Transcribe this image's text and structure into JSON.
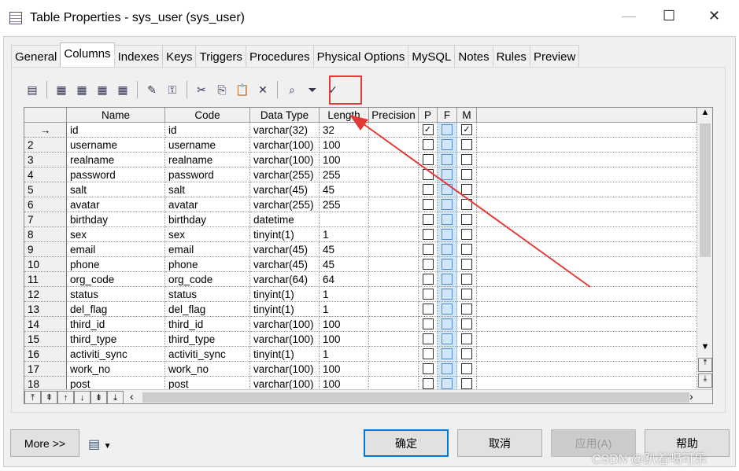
{
  "window": {
    "title": "Table Properties - sys_user (sys_user)",
    "minimize": "—",
    "maximize": "☐",
    "close": "✕"
  },
  "tabs": [
    "General",
    "Columns",
    "Indexes",
    "Keys",
    "Triggers",
    "Procedures",
    "Physical Options",
    "MySQL",
    "Notes",
    "Rules",
    "Preview"
  ],
  "active_tab": "Columns",
  "toolbar": [
    {
      "name": "properties-icon",
      "glyph": "▤"
    },
    {
      "sep": true
    },
    {
      "name": "insert-row-icon",
      "glyph": "▦"
    },
    {
      "name": "add-row-icon",
      "glyph": "▦"
    },
    {
      "name": "add-columns-icon",
      "glyph": "▦"
    },
    {
      "name": "replicate-columns-icon",
      "glyph": "▦"
    },
    {
      "sep": true
    },
    {
      "name": "new-key-icon",
      "glyph": "✎"
    },
    {
      "name": "key-icon",
      "glyph": "⚿"
    },
    {
      "sep": true
    },
    {
      "name": "cut-icon",
      "glyph": "✂"
    },
    {
      "name": "copy-icon",
      "glyph": "⎘"
    },
    {
      "name": "paste-icon",
      "glyph": "📋"
    },
    {
      "name": "delete-icon",
      "glyph": "✕"
    },
    {
      "sep": true
    },
    {
      "name": "find-icon",
      "glyph": "⌕"
    },
    {
      "name": "customize-columns-filter-icon",
      "glyph": "⏷"
    },
    {
      "name": "filter-check-icon",
      "glyph": "✓"
    }
  ],
  "columns": [
    "Name",
    "Code",
    "Data Type",
    "Length",
    "Precision",
    "P",
    "F",
    "M"
  ],
  "rows": [
    {
      "n": "→",
      "name": "id",
      "code": "id",
      "type": "varchar(32)",
      "len": "32",
      "p": true,
      "m": true
    },
    {
      "n": "2",
      "name": "username",
      "code": "username",
      "type": "varchar(100)",
      "len": "100"
    },
    {
      "n": "3",
      "name": "realname",
      "code": "realname",
      "type": "varchar(100)",
      "len": "100"
    },
    {
      "n": "4",
      "name": "password",
      "code": "password",
      "type": "varchar(255)",
      "len": "255"
    },
    {
      "n": "5",
      "name": "salt",
      "code": "salt",
      "type": "varchar(45)",
      "len": "45"
    },
    {
      "n": "6",
      "name": "avatar",
      "code": "avatar",
      "type": "varchar(255)",
      "len": "255"
    },
    {
      "n": "7",
      "name": "birthday",
      "code": "birthday",
      "type": "datetime",
      "len": ""
    },
    {
      "n": "8",
      "name": "sex",
      "code": "sex",
      "type": "tinyint(1)",
      "len": "1"
    },
    {
      "n": "9",
      "name": "email",
      "code": "email",
      "type": "varchar(45)",
      "len": "45"
    },
    {
      "n": "10",
      "name": "phone",
      "code": "phone",
      "type": "varchar(45)",
      "len": "45"
    },
    {
      "n": "11",
      "name": "org_code",
      "code": "org_code",
      "type": "varchar(64)",
      "len": "64"
    },
    {
      "n": "12",
      "name": "status",
      "code": "status",
      "type": "tinyint(1)",
      "len": "1"
    },
    {
      "n": "13",
      "name": "del_flag",
      "code": "del_flag",
      "type": "tinyint(1)",
      "len": "1"
    },
    {
      "n": "14",
      "name": "third_id",
      "code": "third_id",
      "type": "varchar(100)",
      "len": "100"
    },
    {
      "n": "15",
      "name": "third_type",
      "code": "third_type",
      "type": "varchar(100)",
      "len": "100"
    },
    {
      "n": "16",
      "name": "activiti_sync",
      "code": "activiti_sync",
      "type": "tinyint(1)",
      "len": "1"
    },
    {
      "n": "17",
      "name": "work_no",
      "code": "work_no",
      "type": "varchar(100)",
      "len": "100"
    },
    {
      "n": "18",
      "name": "post",
      "code": "post",
      "type": "varchar(100)",
      "len": "100"
    }
  ],
  "nav_buttons": [
    "⤒",
    "⇞",
    "↑",
    "↓",
    "⇟",
    "⤓"
  ],
  "buttons": {
    "more": "More >>",
    "ok": "确定",
    "cancel": "取消",
    "apply": "应用(A)",
    "help": "帮助"
  },
  "watermark": "CSDN @趴着喝可乐",
  "highlight_color": "#e53935"
}
